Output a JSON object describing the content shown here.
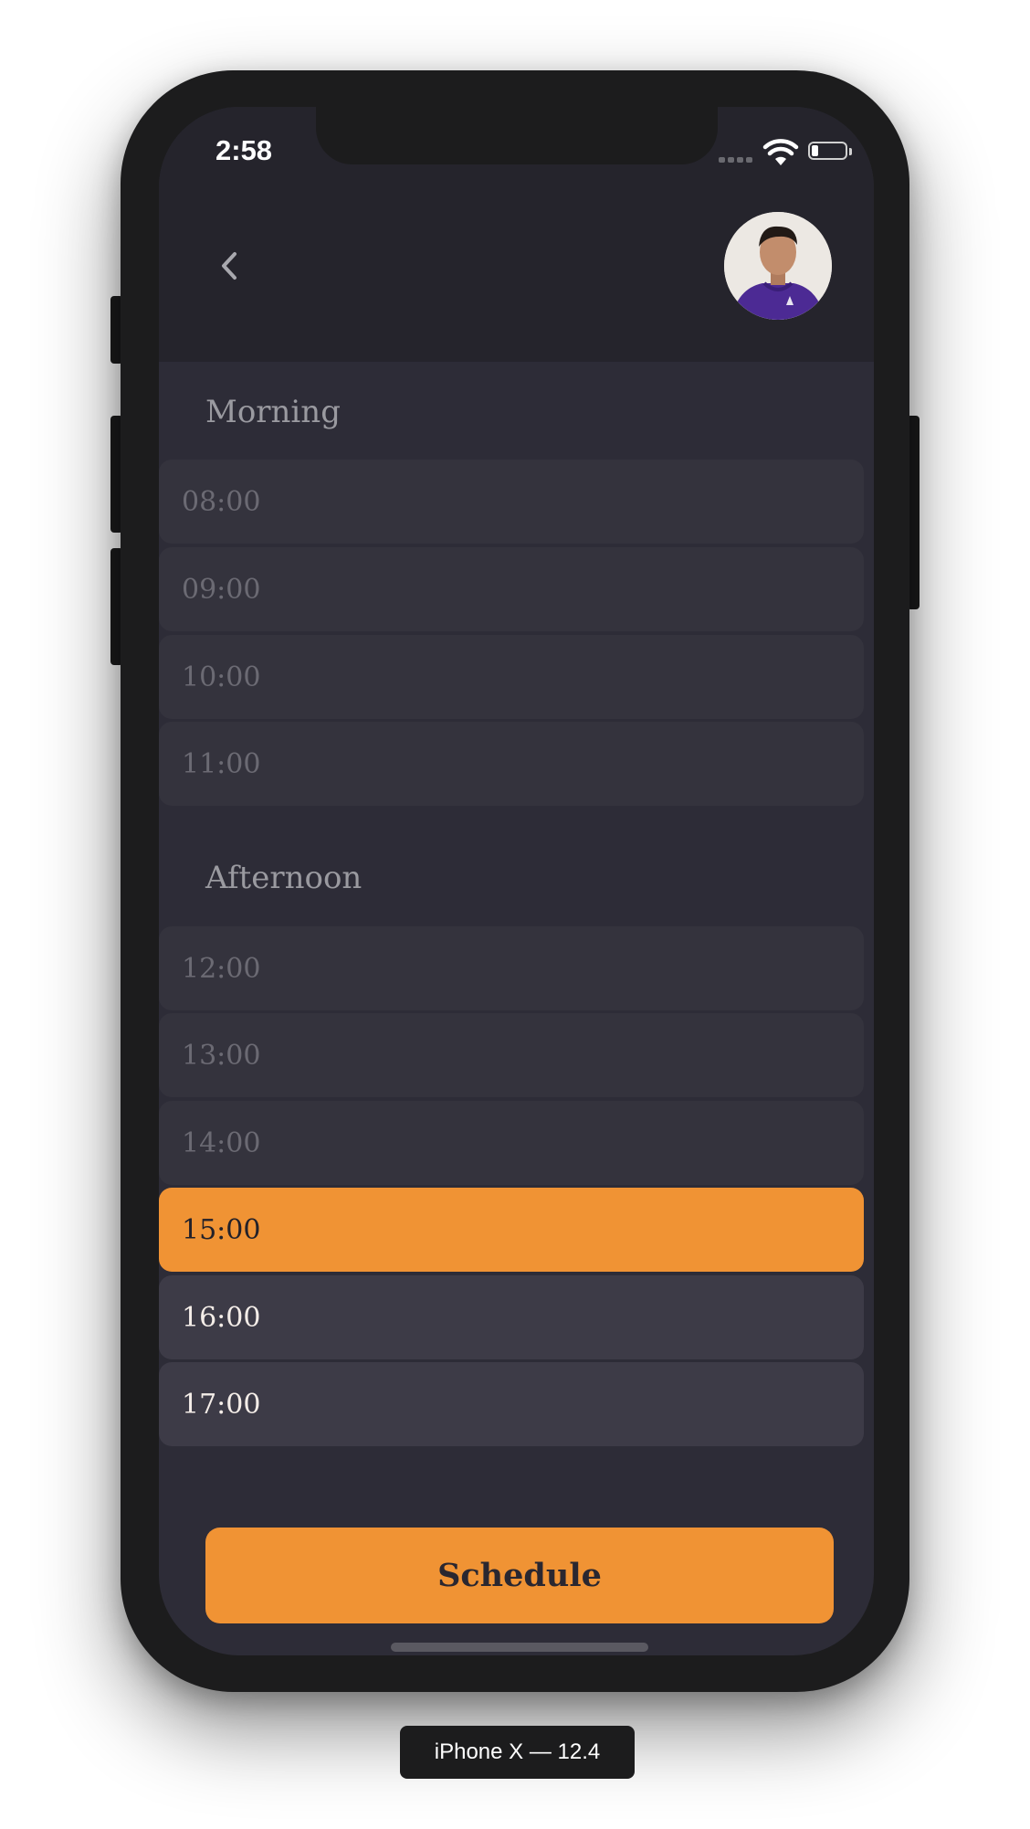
{
  "status_bar": {
    "time": "2:58",
    "battery_level": 0.2
  },
  "header": {
    "back_icon": "chevron-left-icon",
    "avatar": "user-avatar"
  },
  "morning": {
    "title": "Morning",
    "slots": [
      {
        "label": "08:00",
        "state": "unavailable"
      },
      {
        "label": "09:00",
        "state": "unavailable"
      },
      {
        "label": "10:00",
        "state": "unavailable"
      },
      {
        "label": "11:00",
        "state": "unavailable"
      }
    ]
  },
  "afternoon": {
    "title": "Afternoon",
    "slots": [
      {
        "label": "12:00",
        "state": "unavailable"
      },
      {
        "label": "13:00",
        "state": "unavailable"
      },
      {
        "label": "14:00",
        "state": "unavailable"
      },
      {
        "label": "15:00",
        "state": "selected"
      },
      {
        "label": "16:00",
        "state": "available"
      },
      {
        "label": "17:00",
        "state": "available"
      }
    ]
  },
  "schedule_button": {
    "label": "Schedule"
  },
  "device_label": "iPhone X — 12.4",
  "colors": {
    "accent": "#f09334",
    "background": "#2d2c37",
    "header": "#25242c",
    "slot_unavailable": "#34333d",
    "slot_available": "#3d3b47"
  }
}
